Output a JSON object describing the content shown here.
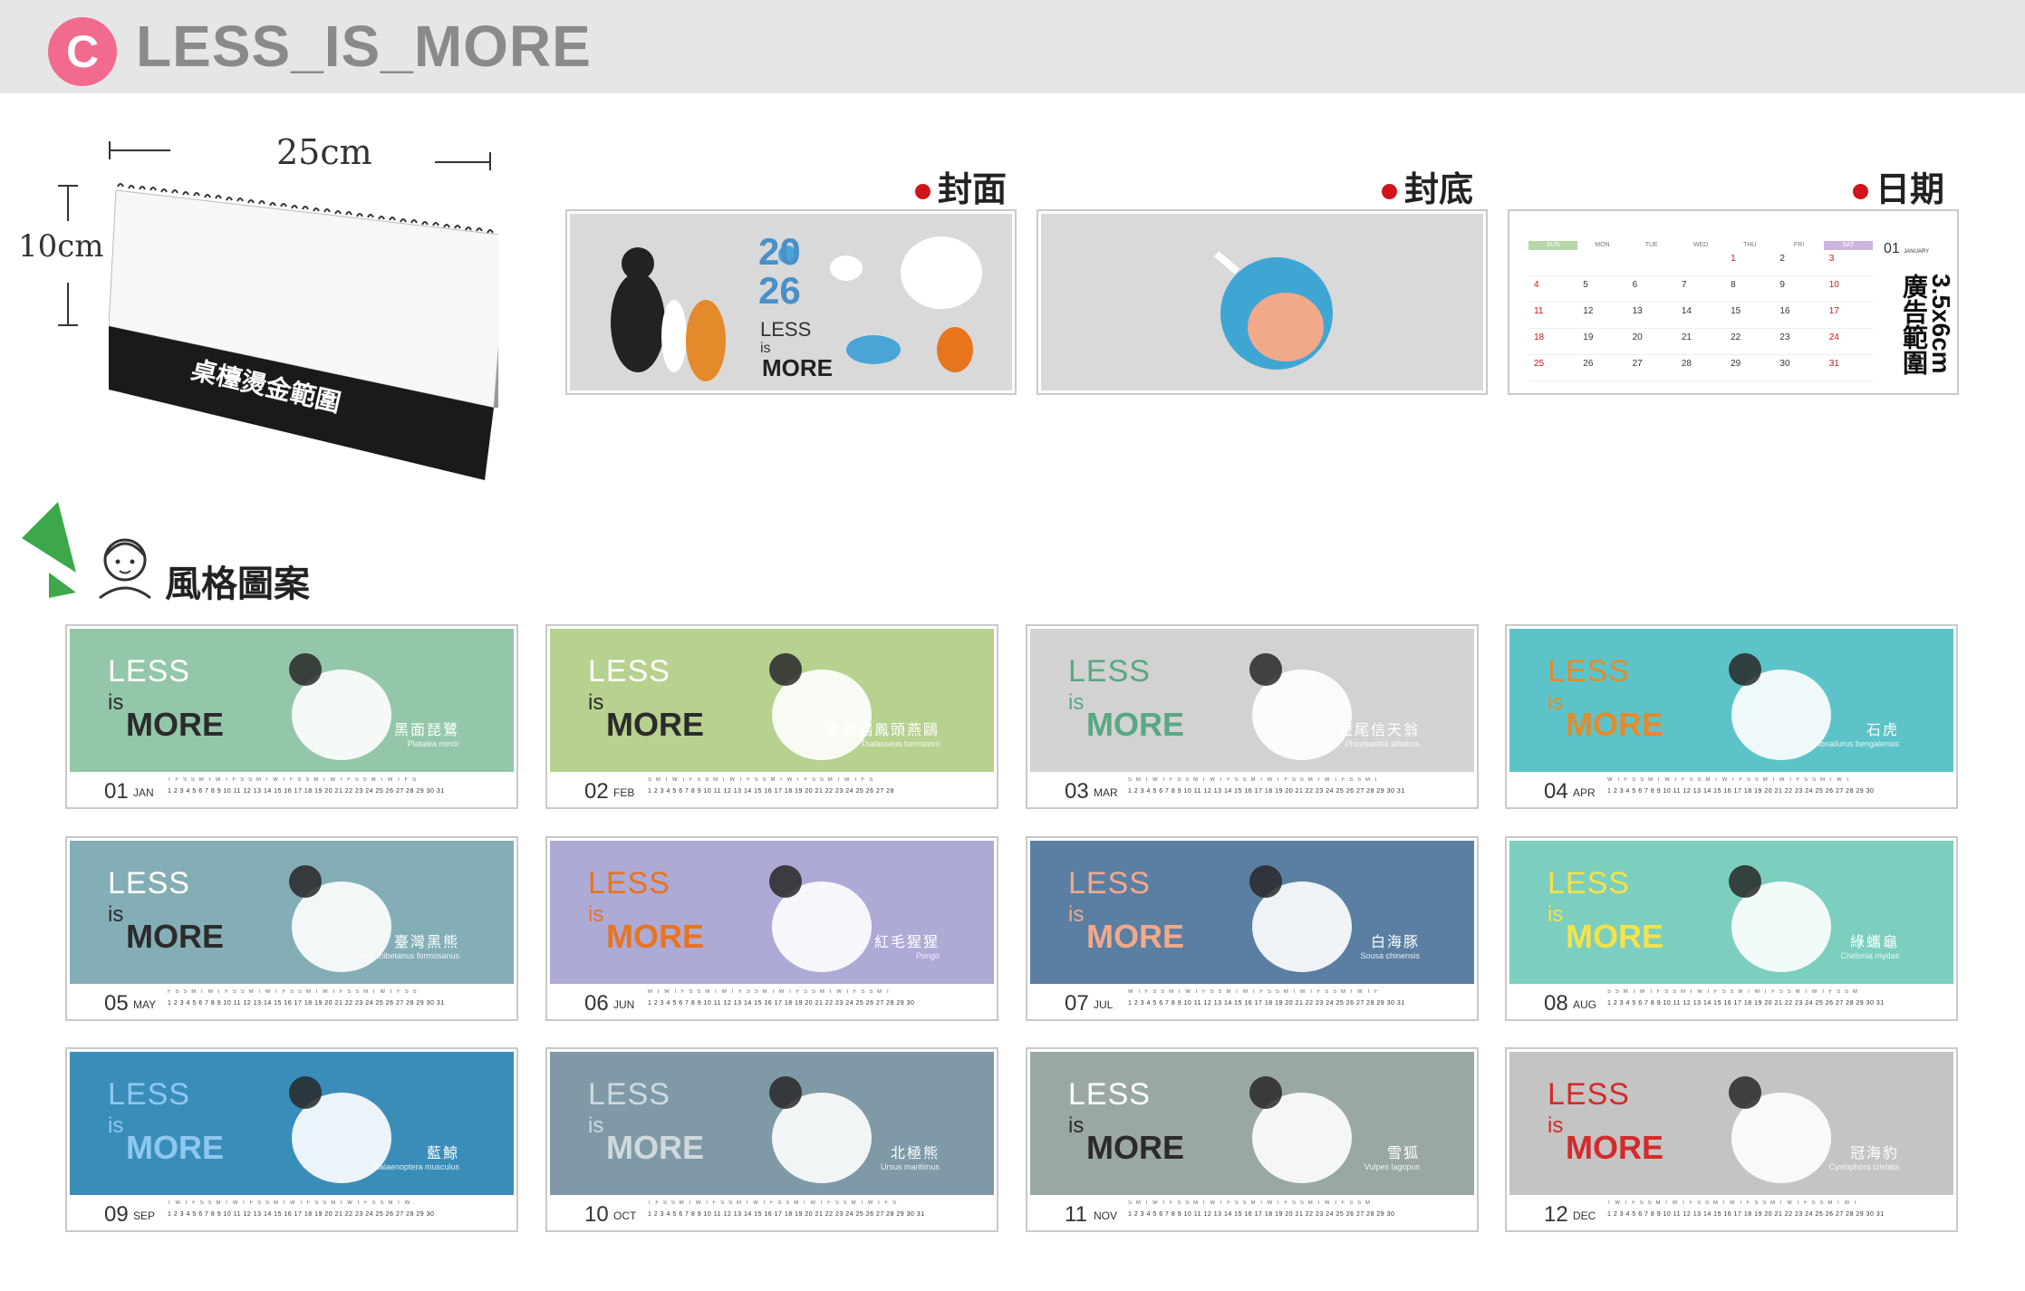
{
  "header": {
    "badge": "C",
    "title": "LESS_IS_MORE"
  },
  "product": {
    "width_label": "25cm",
    "height_label": "10cm",
    "base_label": "桌檯燙金範圍"
  },
  "previews": {
    "cover_label": "封面",
    "back_label": "封底",
    "date_label": "日期",
    "cover_year_top": "20",
    "cover_year_bottom": "26",
    "cover_less": "LESS",
    "cover_is": "is",
    "cover_more": "MORE",
    "date_panel": {
      "weekdays": [
        "SUN",
        "MON",
        "TUE",
        "WED",
        "THU",
        "FRI",
        "SAT"
      ],
      "rows": [
        [
          "",
          "",
          "",
          "",
          "1",
          "2",
          "3"
        ],
        [
          "4",
          "5",
          "6",
          "7",
          "8",
          "9",
          "10"
        ],
        [
          "11",
          "12",
          "13",
          "14",
          "15",
          "16",
          "17"
        ],
        [
          "18",
          "19",
          "20",
          "21",
          "22",
          "23",
          "24"
        ],
        [
          "25",
          "26",
          "27",
          "28",
          "29",
          "30",
          "31"
        ]
      ],
      "month": "01",
      "month_name": "JANUARY",
      "ad_text": "3.5x6cm 廣告範圍"
    }
  },
  "style_section": {
    "label": "風格圖案"
  },
  "months": [
    {
      "num": "01",
      "abbr": "JAN",
      "zh": "黑面琵鷺",
      "latin": "Platalea minor",
      "bg": "#94c7a9",
      "less_color": "#ffffff",
      "more_color": "#2b2b2b",
      "dow": "T F S S M T W T F S S M T W T F S S M T W T F S S M T W T F S",
      "nums": "1 2 3 4 5 6 7 8 9 10 11 12 13 14 15 16 17 18 19 20 21 22 23 24 25 26 27 28 29 30 31"
    },
    {
      "num": "02",
      "abbr": "FEB",
      "zh": "黑嘴端鳳頭燕鷗",
      "latin": "Thalasseus bernsteini",
      "bg": "#b7d18e",
      "less_color": "#ffffff",
      "more_color": "#2b2b2b",
      "dow": "S M T W T F S S M T W T F S S M T W T F S S M T W T F S",
      "nums": "1 2 3 4 5 6 7 8 9 10 11 12 13 14 15 16 17 18 19 20 21 22 23 24 25 26 27 28"
    },
    {
      "num": "03",
      "abbr": "MAR",
      "zh": "短尾信天翁",
      "latin": "Phoebastria albatrus",
      "bg": "#d2d2d2",
      "less_color": "#5aa882",
      "more_color": "#5aa882",
      "dow": "S M T W T F S S M T W T F S S M T W T F S S M T W T F S S M T",
      "nums": "1 2 3 4 5 6 7 8 9 10 11 12 13 14 15 16 17 18 19 20 21 22 23 24 25 26 27 28 29 30 31"
    },
    {
      "num": "04",
      "abbr": "APR",
      "zh": "石虎",
      "latin": "Prionailurus bengalensis",
      "bg": "#5cc4c8",
      "less_color": "#e48a2a",
      "more_color": "#e48a2a",
      "dow": "W T F S S M T W T F S S M T W T F S S M T W T F S S M T W T",
      "nums": "1 2 3 4 5 6 7 8 9 10 11 12 13 14 15 16 17 18 19 20 21 22 23 24 25 26 27 28 29 30"
    },
    {
      "num": "05",
      "abbr": "MAY",
      "zh": "臺灣黑熊",
      "latin": "Ursus thibetanus formosanus",
      "bg": "#84aeb6",
      "less_color": "#ffffff",
      "more_color": "#2b2b2b",
      "dow": "F S S M T W T F S S M T W T F S S M T W T F S S M T W T F S S",
      "nums": "1 2 3 4 5 6 7 8 9 10 11 12 13 14 15 16 17 18 19 20 21 22 23 24 25 26 27 28 29 30 31"
    },
    {
      "num": "06",
      "abbr": "JUN",
      "zh": "紅毛猩猩",
      "latin": "Pongo",
      "bg": "#aeaad6",
      "less_color": "#e8741e",
      "more_color": "#e8741e",
      "dow": "M T W T F S S M T W T F S S M T W T F S S M T W T F S S M T",
      "nums": "1 2 3 4 5 6 7 8 9 10 11 12 13 14 15 16 17 18 19 20 21 22 23 24 25 26 27 28 29 30"
    },
    {
      "num": "07",
      "abbr": "JUL",
      "zh": "白海豚",
      "latin": "Sousa chinensis",
      "bg": "#5b7fa3",
      "less_color": "#f2a98a",
      "more_color": "#f2a98a",
      "dow": "W T F S S M T W T F S S M T W T F S S M T W T F S S M T W T F",
      "nums": "1 2 3 4 5 6 7 8 9 10 11 12 13 14 15 16 17 18 19 20 21 22 23 24 25 26 27 28 29 30 31"
    },
    {
      "num": "08",
      "abbr": "AUG",
      "zh": "綠蠵龜",
      "latin": "Chelonia mydas",
      "bg": "#7ccfbf",
      "less_color": "#f5e24a",
      "more_color": "#f5e24a",
      "dow": "S S M T W T F S S M T W T F S S M T W T F S S M T W T F S S M",
      "nums": "1 2 3 4 5 6 7 8 9 10 11 12 13 14 15 16 17 18 19 20 21 22 23 24 25 26 27 28 29 30 31"
    },
    {
      "num": "09",
      "abbr": "SEP",
      "zh": "藍鯨",
      "latin": "Balaenoptera musculus",
      "bg": "#3a8db8",
      "less_color": "#8fc8ef",
      "more_color": "#8fc8ef",
      "dow": "T W T F S S M T W T F S S M T W T F S S M T W T F S S M T W",
      "nums": "1 2 3 4 5 6 7 8 9 10 11 12 13 14 15 16 17 18 19 20 21 22 23 24 25 26 27 28 29 30"
    },
    {
      "num": "10",
      "abbr": "OCT",
      "zh": "北極熊",
      "latin": "Ursus maritimus",
      "bg": "#7f9aa6",
      "less_color": "#cfd9de",
      "more_color": "#cfd9de",
      "dow": "T F S S M T W T F S S M T W T F S S M T W T F S S M T W T F S",
      "nums": "1 2 3 4 5 6 7 8 9 10 11 12 13 14 15 16 17 18 19 20 21 22 23 24 25 26 27 28 29 30 31"
    },
    {
      "num": "11",
      "abbr": "NOV",
      "zh": "雪狐",
      "latin": "Vulpes lagopus",
      "bg": "#9aa8a4",
      "less_color": "#ffffff",
      "more_color": "#2b2b2b",
      "dow": "S M T W T F S S M T W T F S S M T W T F S S M T W T F S S M",
      "nums": "1 2 3 4 5 6 7 8 9 10 11 12 13 14 15 16 17 18 19 20 21 22 23 24 25 26 27 28 29 30"
    },
    {
      "num": "12",
      "abbr": "DEC",
      "zh": "冠海豹",
      "latin": "Cystophora cristata",
      "bg": "#c4c4c4",
      "less_color": "#d42a2a",
      "more_color": "#d42a2a",
      "dow": "T W T F S S M T W T F S S M T W T F S S M T W T F S S M T W T",
      "nums": "1 2 3 4 5 6 7 8 9 10 11 12 13 14 15 16 17 18 19 20 21 22 23 24 25 26 27 28 29 30 31"
    }
  ],
  "card_less": "LESS",
  "card_is": "is",
  "card_more": "MORE"
}
